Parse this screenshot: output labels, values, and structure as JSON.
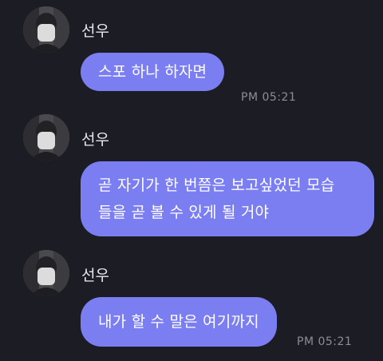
{
  "messages": [
    {
      "sender": "선우",
      "avatar_icon": "profile-avatar",
      "text": "스포 하나 하자면",
      "time": "PM 05:21"
    },
    {
      "sender": "선우",
      "avatar_icon": "profile-avatar",
      "text": "곧 자기가 한 번쯤은 보고싶었던 모습\n들을 곧 볼 수 있게 될 거야",
      "time": ""
    },
    {
      "sender": "선우",
      "avatar_icon": "profile-avatar",
      "text": "내가 할 수 말은 여기까지",
      "time": "PM 05:21"
    }
  ],
  "colors": {
    "background": "#1c1c24",
    "bubble": "#7b7ef0",
    "bubble_text": "#ffffff",
    "sender_text": "#e8e8ee",
    "time_text": "#8d8d96"
  }
}
